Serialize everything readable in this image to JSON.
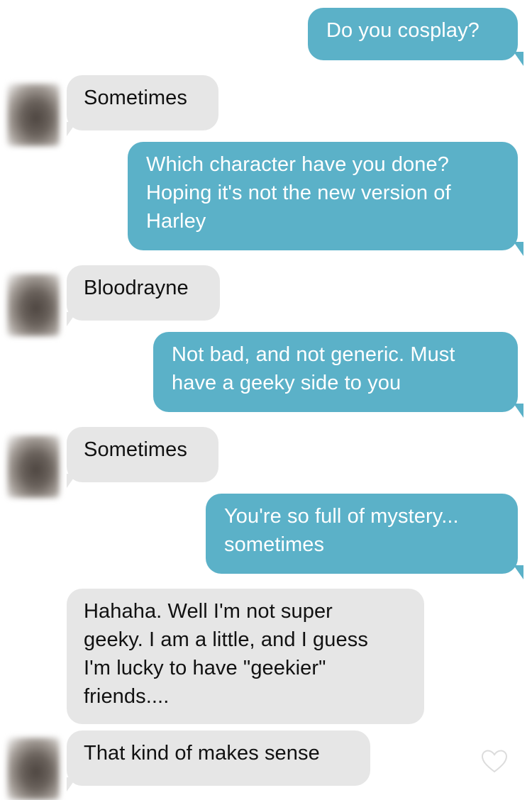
{
  "conversation": {
    "messages": [
      {
        "direction": "outgoing",
        "text": "Do you cosplay?"
      },
      {
        "direction": "incoming",
        "text": "Sometimes"
      },
      {
        "direction": "outgoing",
        "text": "Which character have you done?\nHoping it's not the new version of\nHarley"
      },
      {
        "direction": "incoming",
        "text": "Bloodrayne"
      },
      {
        "direction": "outgoing",
        "text": "Not bad, and not generic. Must\nhave a geeky side to you"
      },
      {
        "direction": "incoming",
        "text": "Sometimes"
      },
      {
        "direction": "outgoing",
        "text": "You're so full of mystery...\nsometimes"
      },
      {
        "direction": "incoming",
        "text": "Hahaha. Well I'm not super\ngeeky. I am a little, and I guess\nI'm lucky to have \"geekier\"\nfriends...."
      },
      {
        "direction": "incoming",
        "text": "That kind of makes sense"
      }
    ]
  },
  "icons": {
    "avatar": "blurred-avatar",
    "like": "heart-outline-icon"
  },
  "colors": {
    "outgoing_bubble": "#5bb1c8",
    "incoming_bubble": "#e6e6e6",
    "outgoing_text": "#ffffff",
    "incoming_text": "#111111"
  }
}
